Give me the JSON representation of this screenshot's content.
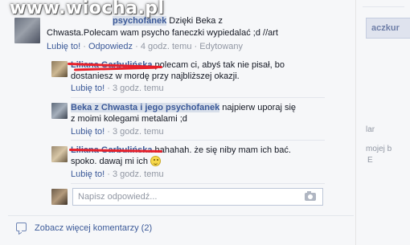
{
  "watermark": "www.wiocha.pl",
  "main_comment": {
    "author": "Beka z Chwasta i jego psychofanek",
    "author_visible": "psychofanek",
    "text_line1": " Dzięki Beka z",
    "text_line2": "Chwasta.Polecam wam psycho faneczki wypiedalać ;d //art",
    "like_label": "Lubię to!",
    "reply_label": "Odpowiedz",
    "time": "4 godz. temu",
    "edited": "Edytowany",
    "sep": "·"
  },
  "replies": [
    {
      "author": "Liliana Garbulińska",
      "text_line1": " polecam ci, abyś tak nie pisał, bo",
      "text_line2": "dostaniesz w mordę przy najbliższej okazji.",
      "like_label": "Lubię to!",
      "time": "3 godz. temu",
      "sep": "·"
    },
    {
      "author": "Beka z Chwasta i jego psychofanek",
      "text_line1": " najpierw uporaj się",
      "text_line2": "z moimi kolegami metalami ;d",
      "like_label": "Lubię to!",
      "time": "3 godz. temu",
      "sep": "·"
    },
    {
      "author": "Liliana Garbulińska",
      "text_line1": " hahahah. że się niby mam ich bać.",
      "text_line2": "spoko. dawaj mi ich ",
      "like_label": "Lubię to!",
      "time": "3 godz. temu",
      "sep": "·"
    }
  ],
  "reply_input": {
    "placeholder": "Napisz odpowiedź..."
  },
  "more_comments": "Zobacz więcej komentarzy (2)",
  "right_strip": {
    "button_fragment": "aczkur",
    "fragment_1": "lar",
    "fragment_2": "mojej b",
    "fragment_3": "E"
  },
  "colors": {
    "link": "#3b5998",
    "meta": "#9197a3",
    "panel_bg": "#f6f7f9",
    "highlight": "#d8dfea",
    "scribble": "#e8202a"
  }
}
